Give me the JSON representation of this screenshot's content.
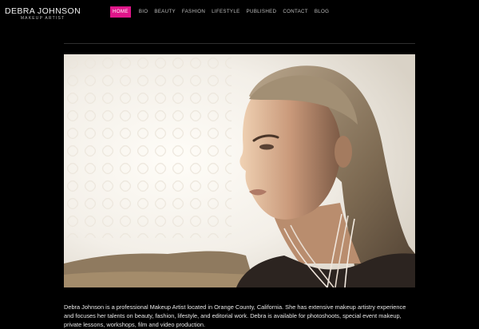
{
  "logo": {
    "name": "DEBRA JOHNSON",
    "subtitle": "MAKEUP ARTIST"
  },
  "nav": {
    "items": [
      "HOME",
      "BIO",
      "BEAUTY",
      "FASHION",
      "LIFESTYLE",
      "PUBLISHED",
      "CONTACT",
      "BLOG"
    ],
    "active_index": 0
  },
  "colors": {
    "accent": "#e0168a",
    "background": "#000000"
  },
  "bio": {
    "text": "Debra Johnson is a professional Makeup Artist located in Orange County, California. She has extensive makeup artistry experience and focuses her talents on beauty, fashion, lifestyle, and editorial work. Debra is available for photoshoots, special event makeup, private lessons, workshops, film and video production."
  }
}
